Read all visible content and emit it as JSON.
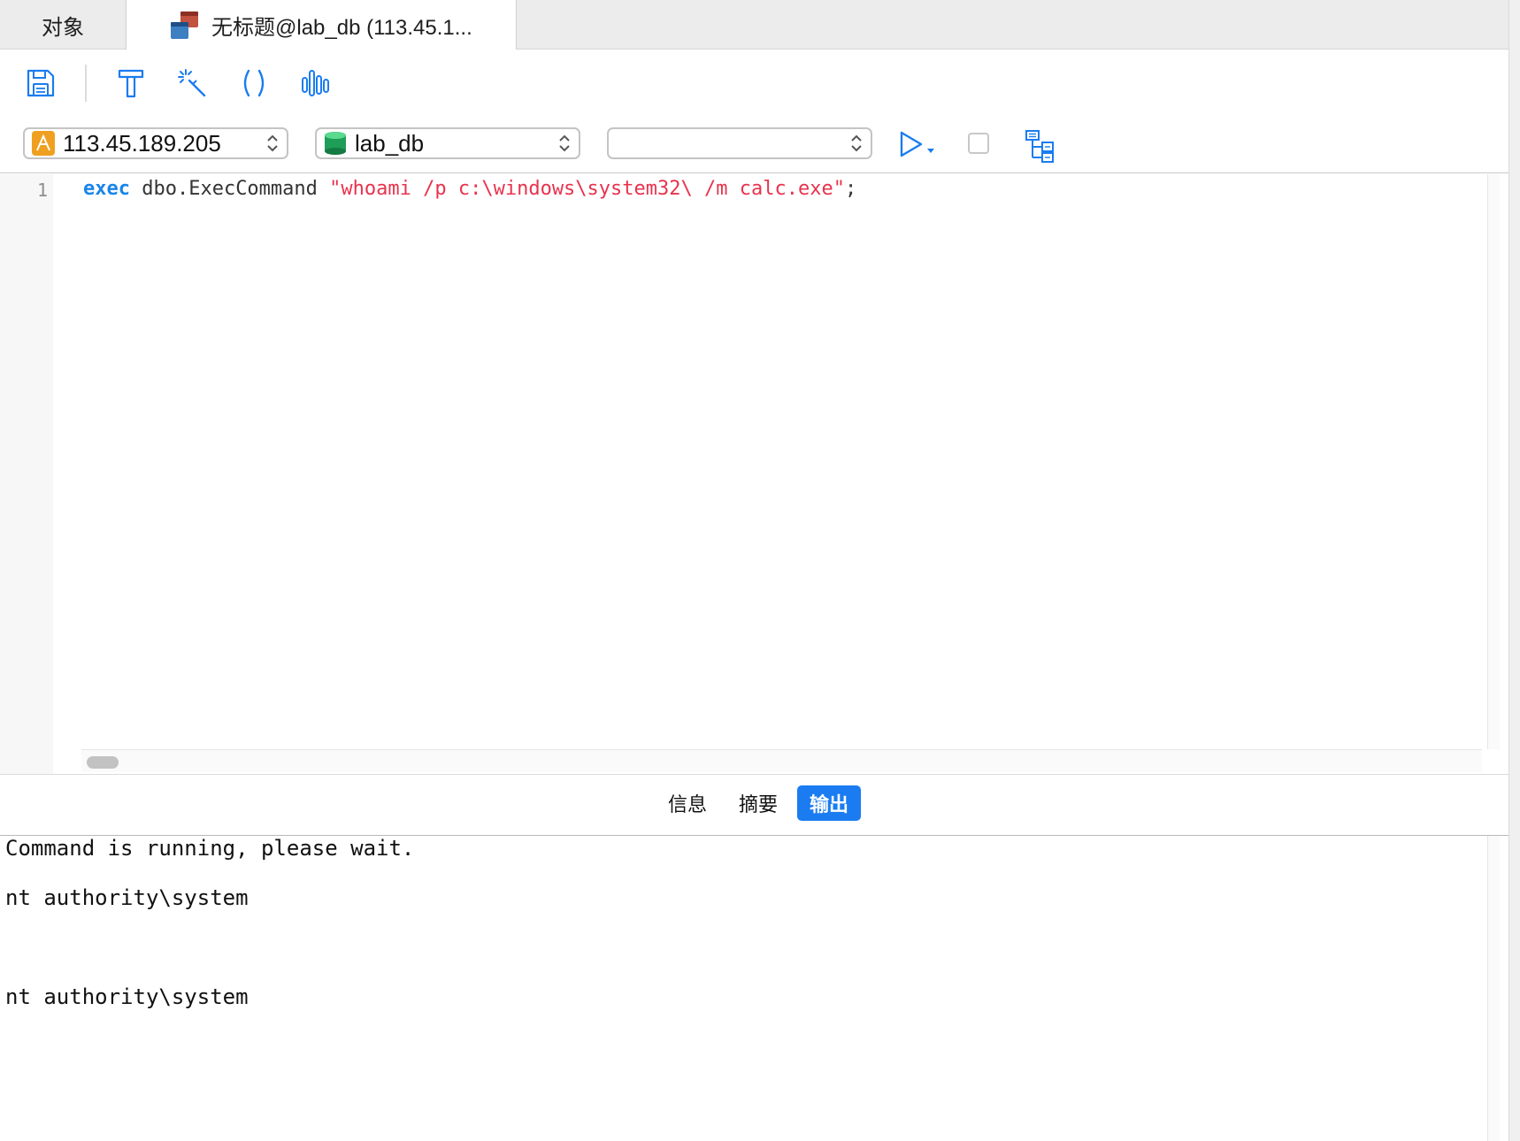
{
  "tabs": {
    "objects_label": "对象",
    "query_label": "无标题@lab_db (113.45.1..."
  },
  "toolbar": {
    "icons": [
      "save-icon",
      "format-icon",
      "beautify-icon",
      "parentheses-icon",
      "waveform-icon"
    ]
  },
  "selectors": {
    "connection": "113.45.189.205",
    "database": "lab_db",
    "schema": ""
  },
  "editor": {
    "line_number": "1",
    "keyword": "exec",
    "object": " dbo.ExecCommand ",
    "string": "\"whoami /p c:\\windows\\system32\\ /m calc.exe\"",
    "terminator": ";"
  },
  "result_tabs": {
    "info": "信息",
    "summary": "摘要",
    "output": "输出"
  },
  "output": {
    "lines": [
      "Command is running, please wait.",
      "nt authority\\system",
      "nt authority\\system"
    ]
  },
  "colors": {
    "accent": "#1a7cf0",
    "keyword": "#1a85e8",
    "string": "#e8334d"
  }
}
